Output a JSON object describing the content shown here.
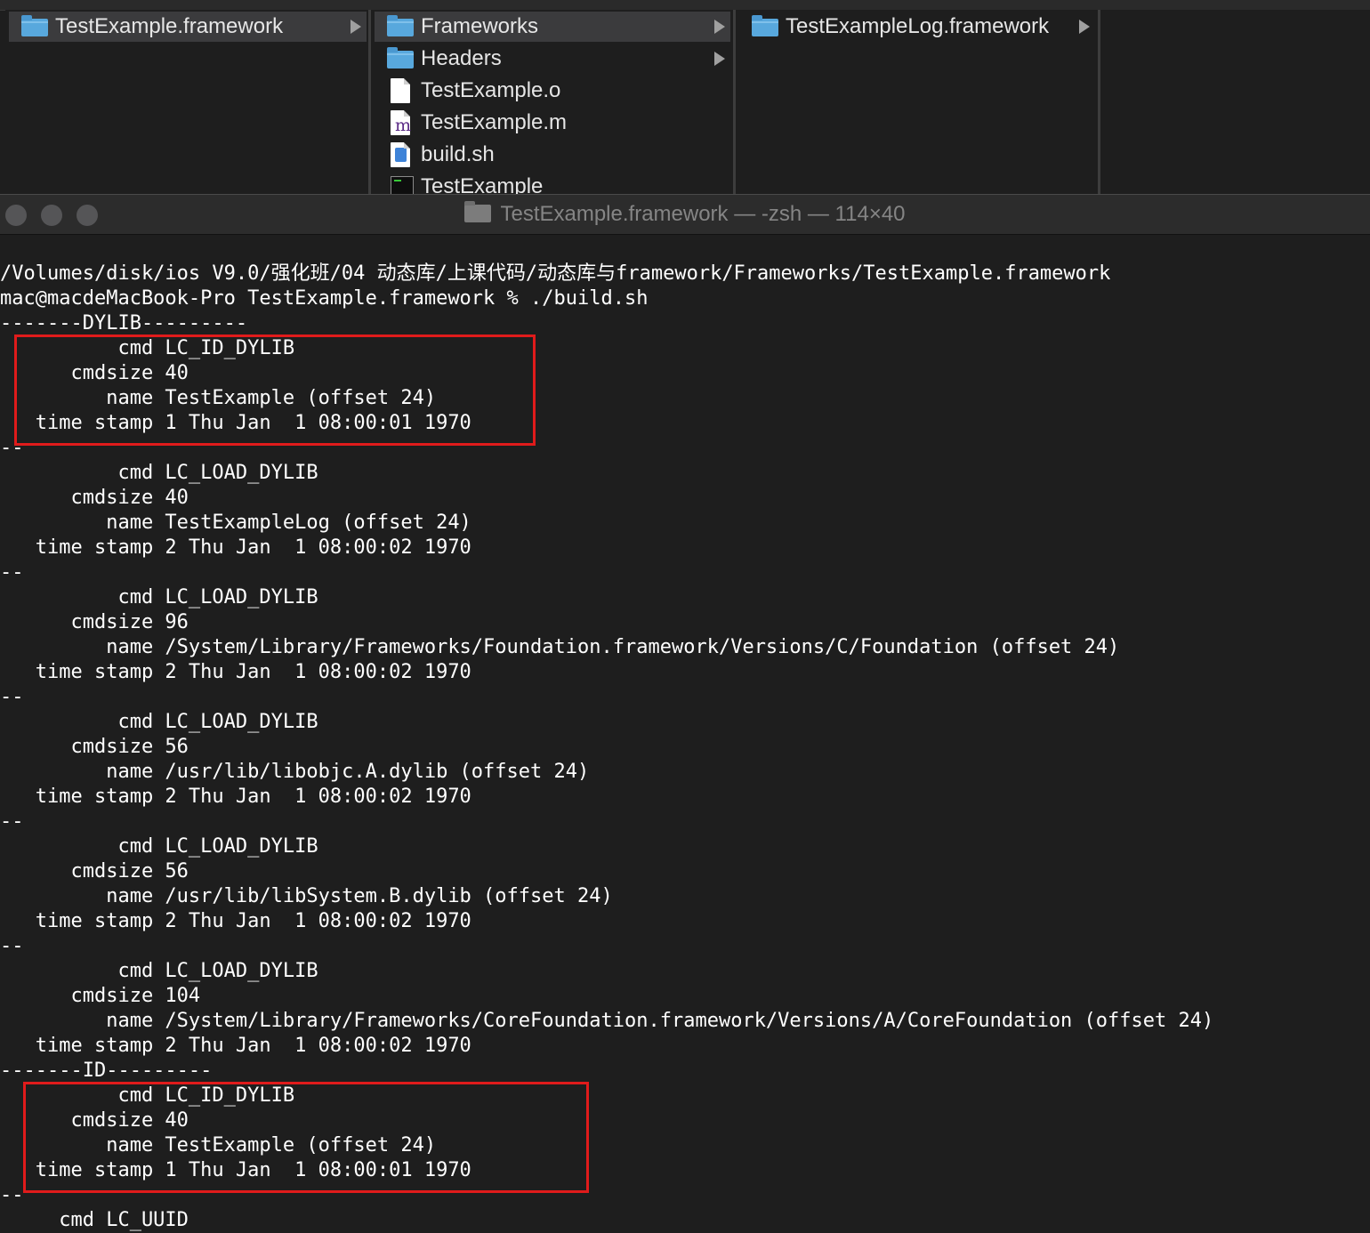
{
  "finder": {
    "columns": [
      {
        "items": [
          {
            "label": "TestExample.framework",
            "icon": "folder-icon",
            "selected": true,
            "has_children": true
          }
        ]
      },
      {
        "items": [
          {
            "label": "Frameworks",
            "icon": "folder-icon",
            "selected": true,
            "has_children": true
          },
          {
            "label": "Headers",
            "icon": "folder-icon",
            "selected": false,
            "has_children": true
          },
          {
            "label": "TestExample.o",
            "icon": "document-icon",
            "selected": false,
            "has_children": false
          },
          {
            "label": "TestExample.m",
            "icon": "objc-source-icon",
            "selected": false,
            "has_children": false
          },
          {
            "label": "build.sh",
            "icon": "shell-script-icon",
            "selected": false,
            "has_children": false
          },
          {
            "label": "TestExample",
            "icon": "executable-icon",
            "selected": false,
            "has_children": false
          }
        ]
      },
      {
        "items": [
          {
            "label": "TestExampleLog.framework",
            "icon": "folder-icon",
            "selected": false,
            "has_children": true
          }
        ]
      },
      {
        "items": []
      }
    ]
  },
  "terminal": {
    "title": "TestExample.framework — -zsh — 114×40",
    "highlight_color": "#e01b1b",
    "lines": [
      "/Volumes/disk/ios V9.0/强化班/04 动态库/上课代码/动态库与framework/Frameworks/TestExample.framework",
      "mac@macdeMacBook-Pro TestExample.framework % ./build.sh",
      "-------DYLIB---------",
      "          cmd LC_ID_DYLIB",
      "      cmdsize 40",
      "         name TestExample (offset 24)",
      "   time stamp 1 Thu Jan  1 08:00:01 1970",
      "--",
      "          cmd LC_LOAD_DYLIB",
      "      cmdsize 40",
      "         name TestExampleLog (offset 24)",
      "   time stamp 2 Thu Jan  1 08:00:02 1970",
      "--",
      "          cmd LC_LOAD_DYLIB",
      "      cmdsize 96",
      "         name /System/Library/Frameworks/Foundation.framework/Versions/C/Foundation (offset 24)",
      "   time stamp 2 Thu Jan  1 08:00:02 1970",
      "--",
      "          cmd LC_LOAD_DYLIB",
      "      cmdsize 56",
      "         name /usr/lib/libobjc.A.dylib (offset 24)",
      "   time stamp 2 Thu Jan  1 08:00:02 1970",
      "--",
      "          cmd LC_LOAD_DYLIB",
      "      cmdsize 56",
      "         name /usr/lib/libSystem.B.dylib (offset 24)",
      "   time stamp 2 Thu Jan  1 08:00:02 1970",
      "--",
      "          cmd LC_LOAD_DYLIB",
      "      cmdsize 104",
      "         name /System/Library/Frameworks/CoreFoundation.framework/Versions/A/CoreFoundation (offset 24)",
      "   time stamp 2 Thu Jan  1 08:00:02 1970",
      "-------ID---------",
      "          cmd LC_ID_DYLIB",
      "      cmdsize 40",
      "         name TestExample (offset 24)",
      "   time stamp 1 Thu Jan  1 08:00:01 1970",
      "--",
      "     cmd LC_UUID"
    ]
  }
}
